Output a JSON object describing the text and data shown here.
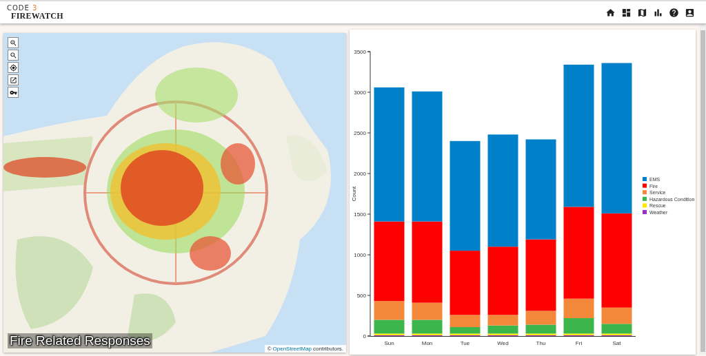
{
  "header": {
    "logo": {
      "word": "CODE",
      "number": "3",
      "product": "FIREWATCH"
    },
    "nav": [
      {
        "kind": "home"
      },
      {
        "kind": "dashboard"
      },
      {
        "kind": "map"
      },
      {
        "kind": "chart"
      },
      {
        "kind": "help"
      },
      {
        "kind": "account"
      }
    ]
  },
  "map": {
    "kind": "picture",
    "title": "Fire Related Responses",
    "attribution_symbol": "©",
    "attribution_link": "OpenStreetMap",
    "attribution_text": "contributors.",
    "controls": [
      {
        "kind": "zoom-in"
      },
      {
        "kind": "zoom-out"
      },
      {
        "kind": "locate"
      },
      {
        "kind": "open"
      },
      {
        "kind": "key"
      }
    ]
  },
  "chart": {
    "chart_data": {
      "type": "bar",
      "stacked": true,
      "ylabel": "Count",
      "categories": [
        "Sun",
        "Mon",
        "Tue",
        "Wed",
        "Thu",
        "Fri",
        "Sat"
      ],
      "ylim": [
        0,
        3500
      ],
      "yticks": [
        0,
        500,
        1000,
        1500,
        2000,
        2500,
        3000,
        3500
      ],
      "legend": true,
      "series": [
        {
          "name": "Weather",
          "color": "#9b30c0",
          "values": [
            10,
            10,
            10,
            10,
            10,
            10,
            10
          ]
        },
        {
          "name": "Rescue",
          "color": "#ffe800",
          "values": [
            20,
            20,
            20,
            20,
            20,
            20,
            20
          ]
        },
        {
          "name": "Hazardous Condition",
          "color": "#3cb54a",
          "values": [
            170,
            170,
            80,
            100,
            110,
            190,
            120
          ]
        },
        {
          "name": "Service",
          "color": "#f4883a",
          "values": [
            230,
            210,
            150,
            130,
            170,
            240,
            200
          ]
        },
        {
          "name": "Fire",
          "color": "#ff0000",
          "values": [
            980,
            1000,
            790,
            840,
            880,
            1130,
            1160
          ]
        },
        {
          "name": "EMS",
          "color": "#0080c8",
          "values": [
            1650,
            1600,
            1350,
            1380,
            1230,
            1750,
            1850
          ]
        }
      ]
    }
  }
}
